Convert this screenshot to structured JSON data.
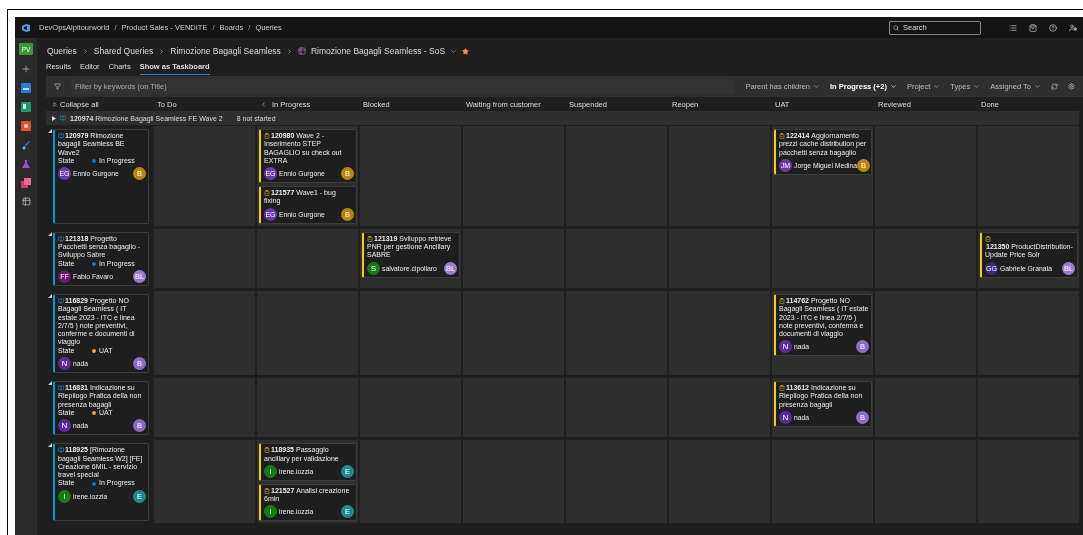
{
  "topbar": {
    "breadcrumb": [
      {
        "label": "DevOpsAlpitourworld"
      },
      {
        "separator": "/",
        "label": "Product Sales - VENDITE"
      },
      {
        "separator": "/",
        "label": "Boards"
      },
      {
        "separator": "/",
        "label": "Queries"
      }
    ],
    "search": {
      "placeholder": "Search"
    }
  },
  "rail": {
    "avatar": "PV"
  },
  "header": {
    "breadcrumb": [
      "Queries",
      "Shared Queries",
      "Rimozione Bagagli Seamless"
    ],
    "title": "Rimozione Bagagli Seamless - SoS",
    "favorite": true
  },
  "tabs": [
    {
      "label": "Results",
      "selected": false
    },
    {
      "label": "Editor",
      "selected": false
    },
    {
      "label": "Charts",
      "selected": false
    },
    {
      "label": "Show as Taskboard",
      "selected": true
    }
  ],
  "filter": {
    "placeholder": "Filter by keywords (on Title)",
    "pickers": [
      {
        "label": "Parent has children",
        "active": false
      },
      {
        "label": "In Progress (+2)",
        "active": true
      },
      {
        "label": "Project",
        "active": false
      },
      {
        "label": "Types",
        "active": false
      },
      {
        "label": "Assigned To",
        "active": false
      }
    ]
  },
  "board": {
    "collapse_all": "Collapse all",
    "columns": [
      {
        "label": "To Do",
        "collapsible": false
      },
      {
        "label": "In Progress",
        "collapsible": true
      },
      {
        "label": "Blocked",
        "collapsible": false
      },
      {
        "label": "Waiting from customer",
        "collapsible": false
      },
      {
        "label": "Suspended",
        "collapsible": false
      },
      {
        "label": "Reopen",
        "collapsible": false
      },
      {
        "label": "UAT",
        "collapsible": false
      },
      {
        "label": "Reviewed",
        "collapsible": false
      },
      {
        "label": "Done",
        "collapsible": false
      }
    ],
    "group": {
      "id": "120974",
      "title": "Rimozione Bagagli Seamless FE Wave 2",
      "summary": "8 not started",
      "expanded": false
    },
    "rows": [
      {
        "expanded": true,
        "parent": {
          "kind": "feature",
          "id": "120979",
          "title": "Rimozione bagagli Seamless BE Wave2",
          "state": {
            "label": "State",
            "value": "In Progress",
            "color": "#0078d4"
          },
          "assignee": "Ennio Gurgone",
          "avatar": {
            "initials": "EG",
            "color": "#6b3aa8"
          },
          "badge": {
            "text": "B",
            "color": "#b8860b"
          }
        },
        "cells": [
          {},
          {
            "cards": [
              {
                "kind": "task",
                "id": "120980",
                "title": "Wave 2 - Inserimento STEP BAGAGLIO su check out EXTRA",
                "assignee": "Ennio Gurgone",
                "avatar": {
                  "initials": "EG",
                  "color": "#6b3aa8"
                },
                "badge": {
                  "text": "B",
                  "color": "#b8860b"
                }
              },
              {
                "kind": "task",
                "id": "121577",
                "title": "Wave1 - bug fixing",
                "assignee": "Ennio Gurgone",
                "avatar": {
                  "initials": "EG",
                  "color": "#6b3aa8"
                },
                "badge": {
                  "text": "B",
                  "color": "#b8860b"
                }
              }
            ]
          },
          {},
          {},
          {},
          {},
          {
            "cards": [
              {
                "kind": "task",
                "id": "122414",
                "title": "Aggiornamento prezzi cache distribution per pacchetti senza bagaglio",
                "assignee": "Jorge Miguel Medina",
                "avatar": {
                  "initials": "JM",
                  "color": "#6b3aa8"
                },
                "badge": {
                  "text": "B",
                  "color": "#b8860b"
                }
              }
            ]
          },
          {},
          {}
        ]
      },
      {
        "expanded": true,
        "parent": {
          "kind": "feature",
          "id": "121318",
          "title": "Progetto Pacchetti senza bagaglio - Sviluppo Sabre",
          "state": {
            "label": "State",
            "value": "In Progress",
            "color": "#0078d4"
          },
          "assignee": "Fabio Favaro",
          "avatar": {
            "initials": "FF",
            "color": "#6a1b6a"
          },
          "badge": {
            "text": "BL",
            "color": "#9a7bd0"
          }
        },
        "cells": [
          {},
          {},
          {
            "cards": [
              {
                "kind": "task",
                "id": "121319",
                "title": "Sviluppo retrieve PNR per gestione Ancillary SABRE",
                "assignee": "salvatore.cipollaro",
                "avatar": {
                  "initials": "S",
                  "color": "#1a7a1a"
                },
                "badge": {
                  "text": "BL",
                  "color": "#9a7bd0"
                }
              }
            ]
          },
          {},
          {},
          {},
          {},
          {},
          {
            "cards": [
              {
                "kind": "task",
                "id": "121350",
                "title": "ProductDistribution-Update Price Solr",
                "assignee": "Gabriele Granata",
                "avatar": {
                  "initials": "GG",
                  "color": "#3f2a78"
                },
                "badge": {
                  "text": "BL",
                  "color": "#9a7bd0"
                }
              }
            ]
          }
        ]
      },
      {
        "expanded": true,
        "parent": {
          "kind": "feature",
          "id": "116829",
          "title": "Progetto NO Bagagli Seamless ( IT estate 2023 - ITC e linea 2/7/5 ) note preventivi, conferme e documenti di viaggio",
          "state": {
            "label": "State",
            "value": "UAT",
            "color": "#f2a31d"
          },
          "assignee": "nada",
          "avatar": {
            "initials": "N",
            "color": "#5b2c9e"
          },
          "badge": {
            "text": "B",
            "color": "#8e6bc6"
          }
        },
        "cells": [
          {},
          {},
          {},
          {},
          {},
          {},
          {
            "cards": [
              {
                "kind": "task",
                "id": "114762",
                "title": "Progetto NO Bagagli Seamless ( IT estate 2023 - ITC e linea 2/7/5 ) note preventivi, conferma e documenti di viaggio",
                "assignee": "nada",
                "avatar": {
                  "initials": "N",
                  "color": "#5b2c9e"
                },
                "badge": {
                  "text": "B",
                  "color": "#8e6bc6"
                }
              }
            ]
          },
          {},
          {}
        ]
      },
      {
        "expanded": true,
        "parent": {
          "kind": "feature",
          "id": "116831",
          "title": "Indicazione su Riepilogo Pratica della non presenza bagagli",
          "state": {
            "label": "State",
            "value": "UAT",
            "color": "#f2a31d"
          },
          "assignee": "nada",
          "avatar": {
            "initials": "N",
            "color": "#5b2c9e"
          },
          "badge": {
            "text": "B",
            "color": "#8e6bc6"
          }
        },
        "cells": [
          {},
          {},
          {},
          {},
          {},
          {},
          {
            "cards": [
              {
                "kind": "task",
                "id": "113612",
                "title": "Indicazione su Riepilogo Pratica della non presenza bagagli",
                "assignee": "nada",
                "avatar": {
                  "initials": "N",
                  "color": "#5b2c9e"
                },
                "badge": {
                  "text": "B",
                  "color": "#8e6bc6"
                }
              }
            ]
          },
          {},
          {}
        ]
      },
      {
        "expanded": true,
        "parent": {
          "kind": "feature",
          "id": "118925",
          "title": "[Rimozione bagagli Seamless W2] [FE] Creazione 6MIL - servizio travel special",
          "state": {
            "label": "State",
            "value": "In Progress",
            "color": "#0078d4"
          },
          "assignee": "irene.iozzia",
          "avatar": {
            "initials": "I",
            "color": "#1a7a1a"
          },
          "badge": {
            "text": "E",
            "color": "#1f8a8a"
          }
        },
        "cells": [
          {},
          {
            "cards": [
              {
                "kind": "task",
                "id": "118935",
                "title": "Passaggio ancillary per validazione",
                "assignee": "irene.iozzia",
                "avatar": {
                  "initials": "I",
                  "color": "#1a7a1a"
                },
                "badge": {
                  "text": "E",
                  "color": "#1f8a8a"
                }
              },
              {
                "kind": "task",
                "id": "121527",
                "title": "Analisi creazione 6min",
                "assignee": "irene.iozzia",
                "avatar": {
                  "initials": "I",
                  "color": "#1a7a1a"
                },
                "badge": {
                  "text": "E",
                  "color": "#1f8a8a"
                }
              }
            ]
          },
          {},
          {},
          {},
          {},
          {},
          {},
          {}
        ]
      }
    ]
  }
}
